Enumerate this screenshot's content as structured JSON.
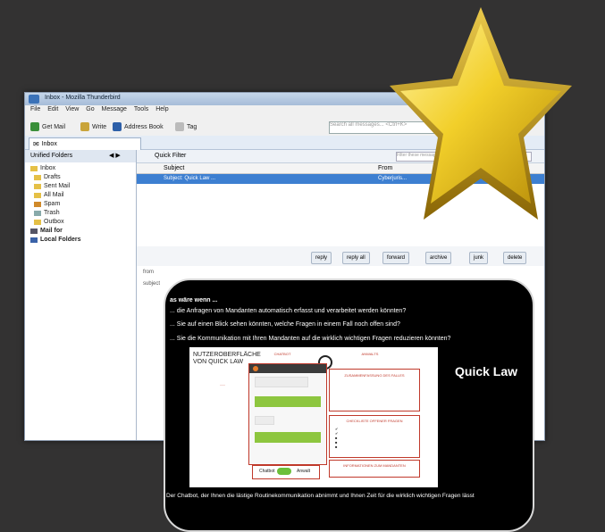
{
  "window": {
    "title": "Inbox - Mozilla Thunderbird",
    "menu": [
      "File",
      "Edit",
      "View",
      "Go",
      "Message",
      "Tools",
      "Help"
    ],
    "toolbar": {
      "get_mail": "Get Mail",
      "write": "Write",
      "address_book": "Address Book",
      "tag": "Tag"
    },
    "search_placeholder": "Search all messages... <Ctrl+K>",
    "tab_label": "Inbox",
    "folders_header": "Unified Folders",
    "folders": [
      "Inbox",
      "Drafts",
      "Sent Mail",
      "All Mail",
      "Spam",
      "Trash",
      "Outbox",
      "Mail for",
      "Local Folders"
    ],
    "quick_filter": "Quick Filter",
    "filter_placeholder": "Filter these messages <Ctrl+Shift+K>",
    "columns": {
      "subject": "Subject",
      "from": "From"
    },
    "selected_subject": "Subject: Quick Law ...",
    "selected_from": "Cyberjuris...",
    "actions": [
      "reply",
      "reply all",
      "forward",
      "archive",
      "junk",
      "delete"
    ],
    "preview_from_label": "from",
    "preview_subject_label": "subject"
  },
  "overlay": {
    "heading": "as wäre wenn ...",
    "lines": [
      "... die Anfragen von Mandanten automatisch erfasst und verarbeitet werden könnten?",
      "... Sie auf einen Blick sehen könnten, welche Fragen in einem Fall noch offen sind?",
      "... Sie die Kommunikation mit Ihren Mandanten auf die wirklich wichtigen Fragen reduzieren könnten?"
    ],
    "brand": "Quick Law",
    "footer": "Der Chatbot, der Ihnen die lästige Routinekommunikation abnimmt und Ihnen Zeit für die wirklich wichtigen Fragen lässt",
    "mock": {
      "title_line1": "NUTZEROBERFLÄCHE",
      "title_line2": "VON QUICK LAW",
      "chatbot_label": "CHATBOT",
      "anwalt_label": "ANWALTS",
      "box1": "ZUSAMMENFASSUNG DES FALLES",
      "box2": "CHECKLISTE OFFENER FRAGEN",
      "box3": "INFORMATIONEN ZUM MANDANTEN",
      "toggle_left": "Chatbot",
      "toggle_right": "Anwalt"
    }
  },
  "colors": {
    "accent_red": "#c0392b",
    "accent_green": "#8dc63f",
    "star_gold": "#e8c21a",
    "selection_blue": "#3d7fd1"
  }
}
